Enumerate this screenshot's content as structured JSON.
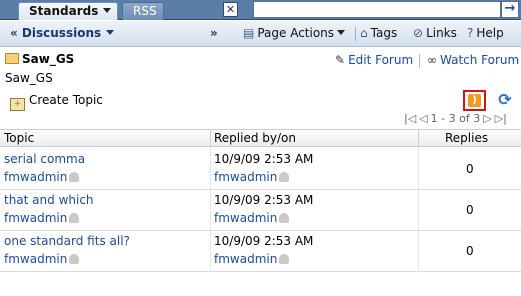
{
  "tabs": [
    {
      "label": "Standards"
    },
    {
      "label": "RSS"
    }
  ],
  "search": {
    "placeholder": ""
  },
  "header": {
    "title": "« Discussions",
    "expand": "»",
    "page_actions": "Page Actions",
    "tags": "Tags",
    "links": "Links",
    "help": "Help"
  },
  "forum": {
    "name": "Saw_GS",
    "subtitle": "Saw_GS",
    "edit_label": "Edit Forum",
    "watch_label": "Watch Forum"
  },
  "toolbar": {
    "create_topic": "Create Topic"
  },
  "pager": {
    "text": "1 - 3 of 3"
  },
  "table": {
    "headers": [
      "Topic",
      "Replied by/on",
      "Replies"
    ],
    "rows": [
      {
        "topic": "serial comma",
        "author": "fmwadmin",
        "date": "10/9/09 2:53 AM",
        "replier": "fmwadmin",
        "replies": "0"
      },
      {
        "topic": "that and which",
        "author": "fmwadmin",
        "date": "10/9/09 2:53 AM",
        "replier": "fmwadmin",
        "replies": "0"
      },
      {
        "topic": "one standard fits all?",
        "author": "fmwadmin",
        "date": "10/9/09 2:53 AM",
        "replier": "fmwadmin",
        "replies": "0"
      }
    ]
  }
}
